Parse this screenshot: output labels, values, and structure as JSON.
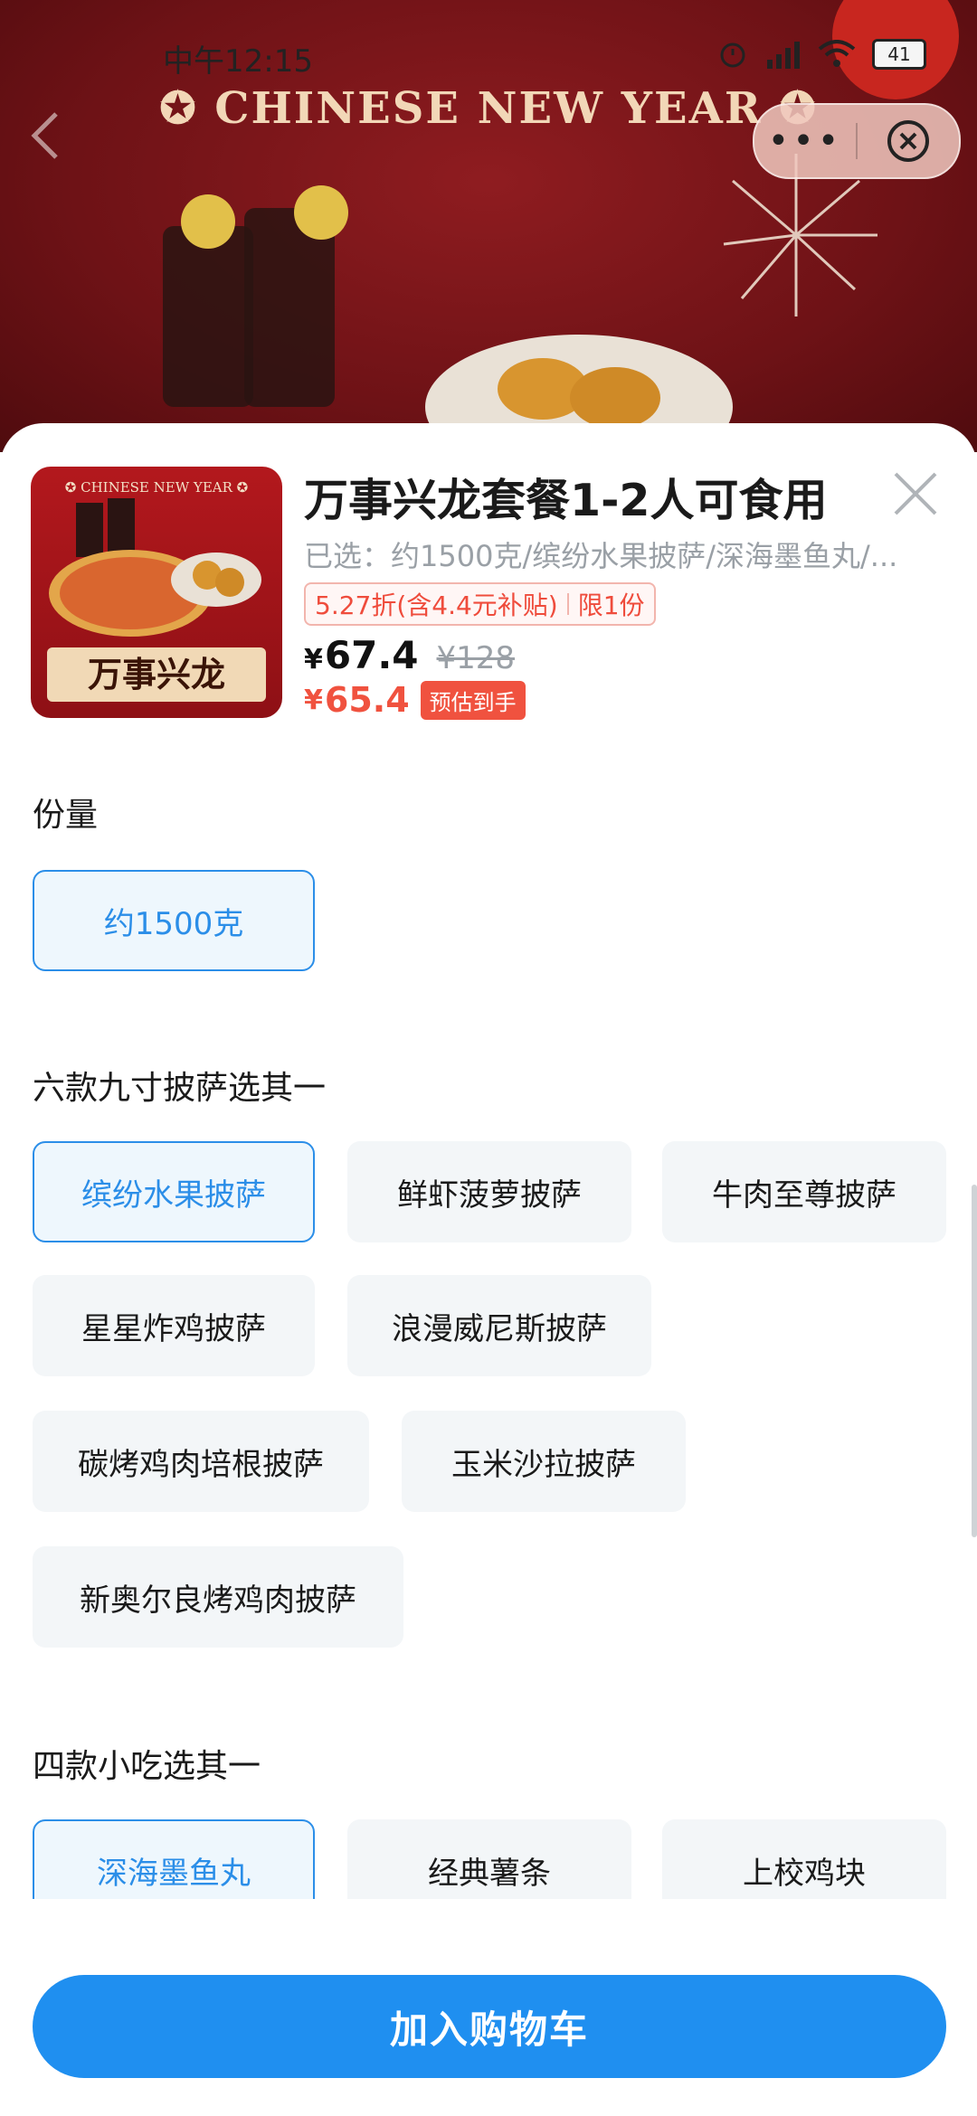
{
  "status_bar": {
    "time": "中午12:15",
    "battery": "41"
  },
  "banner": {
    "title": "✪ CHINESE NEW YEAR ✪"
  },
  "capsule": {
    "more": "•••"
  },
  "product": {
    "thumb_top_text": "✪ CHINESE NEW YEAR ✪",
    "thumb_name": "万事兴龙",
    "title": "万事兴龙套餐1-2人可食用",
    "selected": "已选：约1500克/缤纷水果披萨/深海墨鱼丸/...",
    "promo_discount": "5.27折(含4.4元补贴)",
    "promo_limit": "限1份",
    "currency": "¥",
    "price": "67.4",
    "original_price": "¥128",
    "net_price": "65.4",
    "net_tag": "预估到手"
  },
  "sections": [
    {
      "title": "份量",
      "options": [
        "约1500克"
      ]
    },
    {
      "title": "六款九寸披萨选其一",
      "options": [
        "缤纷水果披萨",
        "鲜虾菠萝披萨",
        "牛肉至尊披萨",
        "星星炸鸡披萨",
        "浪漫威尼斯披萨",
        "碳烤鸡肉培根披萨",
        "玉米沙拉披萨",
        "新奥尔良烤鸡肉披萨"
      ]
    },
    {
      "title": "四款小吃选其一",
      "options": [
        "深海墨鱼丸",
        "经典薯条",
        "上校鸡块"
      ]
    }
  ],
  "cart_button": "加入购物车",
  "colors": {
    "accent": "#1f8ff0",
    "price_red": "#f0523f",
    "banner_red": "#8f1c20"
  }
}
